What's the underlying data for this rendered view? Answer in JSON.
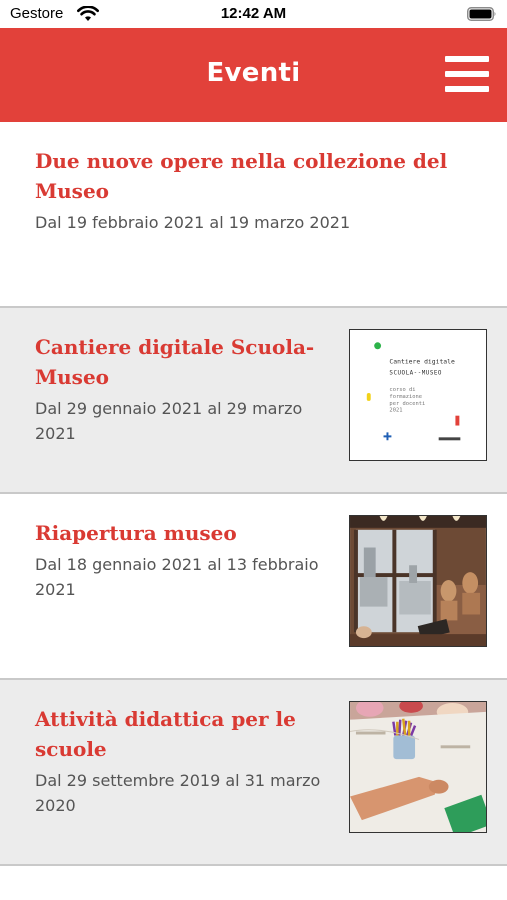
{
  "status_bar": {
    "carrier": "Gestore",
    "time": "12:42 AM",
    "wifi_icon": "wifi-icon",
    "battery_icon": "battery-full-icon"
  },
  "header": {
    "title": "Eventi",
    "menu_icon": "hamburger-menu-icon",
    "background_color": "#e2413a"
  },
  "events": [
    {
      "title": "Due nuove opere nella collezione del Museo",
      "dates": "Dal 19 febbraio 2021 al 19 marzo 2021",
      "thumbnail": null
    },
    {
      "title": "Cantiere digitale Scuola-Museo",
      "dates": "Dal 29 gennaio 2021 al 29 marzo 2021",
      "thumbnail": {
        "kind": "poster",
        "line1": "Cantiere digitale",
        "line2": "SCUOLA--MUSEO",
        "line3": "corso di",
        "line4": "formazione",
        "line5": "per docenti",
        "line6": "2021"
      }
    },
    {
      "title": "Riapertura museo",
      "dates": "Dal 18 gennaio 2021 al 13 febbraio 2021",
      "thumbnail": {
        "kind": "photo-museum-room"
      }
    },
    {
      "title": "Attività didattica per le scuole",
      "dates": "Dal 29 settembre 2019 al 31 marzo 2020",
      "thumbnail": {
        "kind": "photo-classroom-table"
      }
    }
  ],
  "colors": {
    "accent": "#e2413a",
    "title_red": "#d93a33",
    "alt_row": "#ececec",
    "date_text": "#555555"
  }
}
